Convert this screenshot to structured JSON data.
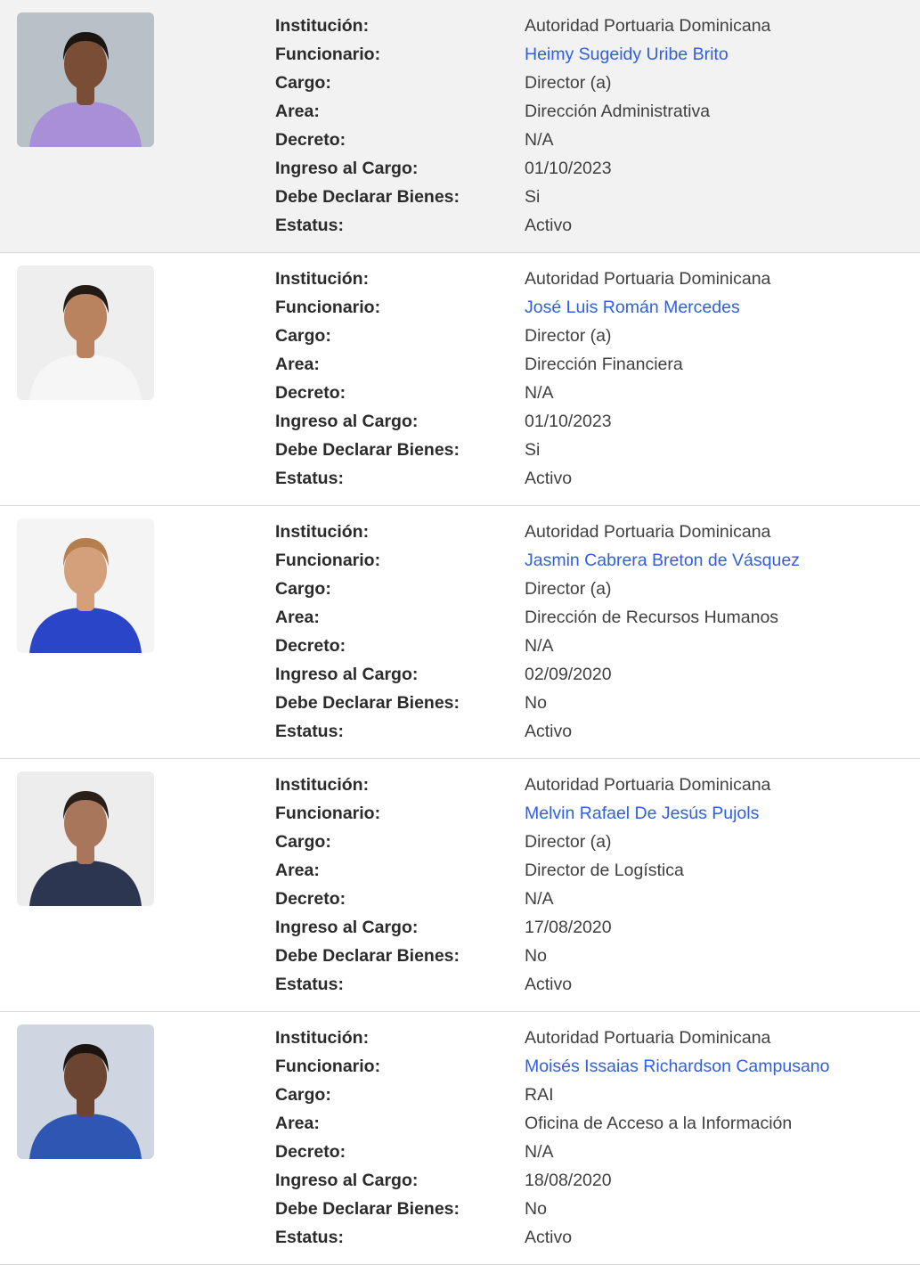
{
  "labels": {
    "institucion": "Institución:",
    "funcionario": "Funcionario:",
    "cargo": "Cargo:",
    "area": "Area:",
    "decreto": "Decreto:",
    "ingreso": "Ingreso al Cargo:",
    "declarar": "Debe Declarar Bienes:",
    "estatus": "Estatus:"
  },
  "records": [
    {
      "institucion": "Autoridad Portuaria Dominicana",
      "funcionario": "Heimy Sugeidy Uribe Brito",
      "cargo": "Director (a)",
      "area": "Dirección Administrativa",
      "decreto": "N/A",
      "ingreso": "01/10/2023",
      "declarar": "Si",
      "estatus": "Activo",
      "highlighted": true,
      "photo": {
        "bg": "#b8c0c8",
        "skin": "#7a4e36",
        "hair": "#1b1411",
        "shirt": "#a98fd6"
      }
    },
    {
      "institucion": "Autoridad Portuaria Dominicana",
      "funcionario": "José Luis Román Mercedes",
      "cargo": "Director (a)",
      "area": "Dirección Financiera",
      "decreto": "N/A",
      "ingreso": "01/10/2023",
      "declarar": "Si",
      "estatus": "Activo",
      "highlighted": false,
      "photo": {
        "bg": "#eeeeee",
        "skin": "#b98360",
        "hair": "#231a15",
        "shirt": "#f6f6f6"
      }
    },
    {
      "institucion": "Autoridad Portuaria Dominicana",
      "funcionario": "Jasmin Cabrera Breton de Vásquez",
      "cargo": "Director (a)",
      "area": "Dirección de Recursos Humanos",
      "decreto": "N/A",
      "ingreso": "02/09/2020",
      "declarar": "No",
      "estatus": "Activo",
      "highlighted": false,
      "photo": {
        "bg": "#f4f4f4",
        "skin": "#d4a07c",
        "hair": "#b57e4e",
        "shirt": "#2b45c9"
      }
    },
    {
      "institucion": "Autoridad Portuaria Dominicana",
      "funcionario": "Melvin Rafael De Jesús Pujols",
      "cargo": "Director (a)",
      "area": "Director de Logística",
      "decreto": "N/A",
      "ingreso": "17/08/2020",
      "declarar": "No",
      "estatus": "Activo",
      "highlighted": false,
      "photo": {
        "bg": "#ededed",
        "skin": "#a8765a",
        "hair": "#2a1f19",
        "shirt": "#2c3650"
      }
    },
    {
      "institucion": "Autoridad Portuaria Dominicana",
      "funcionario": "Moisés Issaias Richardson Campusano",
      "cargo": "RAI",
      "area": "Oficina de Acceso a la Información",
      "decreto": "N/A",
      "ingreso": "18/08/2020",
      "declarar": "No",
      "estatus": "Activo",
      "highlighted": false,
      "photo": {
        "bg": "#cfd6e2",
        "skin": "#6b4432",
        "hair": "#1a1310",
        "shirt": "#2f56b3"
      }
    }
  ]
}
